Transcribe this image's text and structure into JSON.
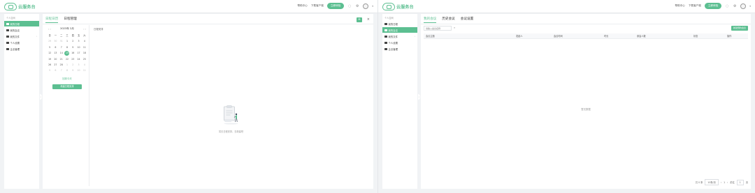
{
  "brand": {
    "name": "云服务台",
    "accent": "#5cbf91"
  },
  "topnav": {
    "links": [
      "帮助中心",
      "下载客户端"
    ],
    "cta": "立即体验",
    "icons": [
      "notification-icon",
      "settings-icon"
    ]
  },
  "left_screen": {
    "sidebar": {
      "section_title": "个人空间",
      "items": [
        {
          "label": "我的日程",
          "active": true
        },
        {
          "label": "我的会议",
          "active": false
        },
        {
          "label": "我的文件",
          "active": false,
          "has_arrow": true
        },
        {
          "label": "个人设置",
          "active": false
        },
        {
          "label": "企业管理",
          "active": false
        }
      ]
    },
    "tabs": [
      {
        "label": "日程日历",
        "active": true
      },
      {
        "label": "日程管理",
        "active": false
      }
    ],
    "toolbar": {
      "add": "+",
      "close": "×"
    },
    "calendar": {
      "prev": "‹ ‹",
      "month_label": "2023年 2月",
      "next": "› ›",
      "weekdays": [
        "日",
        "一",
        "二",
        "三",
        "四",
        "五",
        "六"
      ],
      "days": [
        [
          "29",
          "30",
          "31",
          "1",
          "2",
          "3",
          "4"
        ],
        [
          "5",
          "6",
          "7",
          "8",
          "9",
          "10",
          "11"
        ],
        [
          "12",
          "13",
          "14",
          "15",
          "16",
          "17",
          "18"
        ],
        [
          "19",
          "20",
          "21",
          "22",
          "23",
          "24",
          "25"
        ],
        [
          "26",
          "27",
          "28",
          "1",
          "2",
          "3",
          "4"
        ],
        [
          "5",
          "6",
          "7",
          "8",
          "9",
          "10",
          "11"
        ]
      ],
      "today": "15",
      "link": "回到今天",
      "action": "新建日程安排"
    },
    "schedule": {
      "label": "日程安排",
      "empty_text": "暂无日程安排，去新建吧"
    }
  },
  "right_screen": {
    "sidebar": {
      "section_title": "个人空间",
      "items": [
        {
          "label": "我的日程",
          "active": false
        },
        {
          "label": "我的会议",
          "active": true
        },
        {
          "label": "我的文件",
          "active": false,
          "has_arrow": true
        },
        {
          "label": "个人设置",
          "active": false
        },
        {
          "label": "企业管理",
          "active": false
        }
      ]
    },
    "tabs": [
      {
        "label": "我的会议",
        "active": true
      },
      {
        "label": "历史会议",
        "active": false
      },
      {
        "label": "会议设置",
        "active": false
      }
    ],
    "search": {
      "placeholder": "请输入会议名称"
    },
    "new_button": "新建预约会议",
    "columns": [
      "会议主题",
      "发起人",
      "会议时间",
      "时长",
      "参会人数",
      "状态",
      "操作"
    ],
    "no_data": "暂无数据",
    "pager": {
      "total": "共 0 条",
      "page_size": "10条/页",
      "prev": "‹",
      "page": "1",
      "next": "›",
      "goto": "前往",
      "goto_page": "1",
      "unit": "页"
    }
  }
}
